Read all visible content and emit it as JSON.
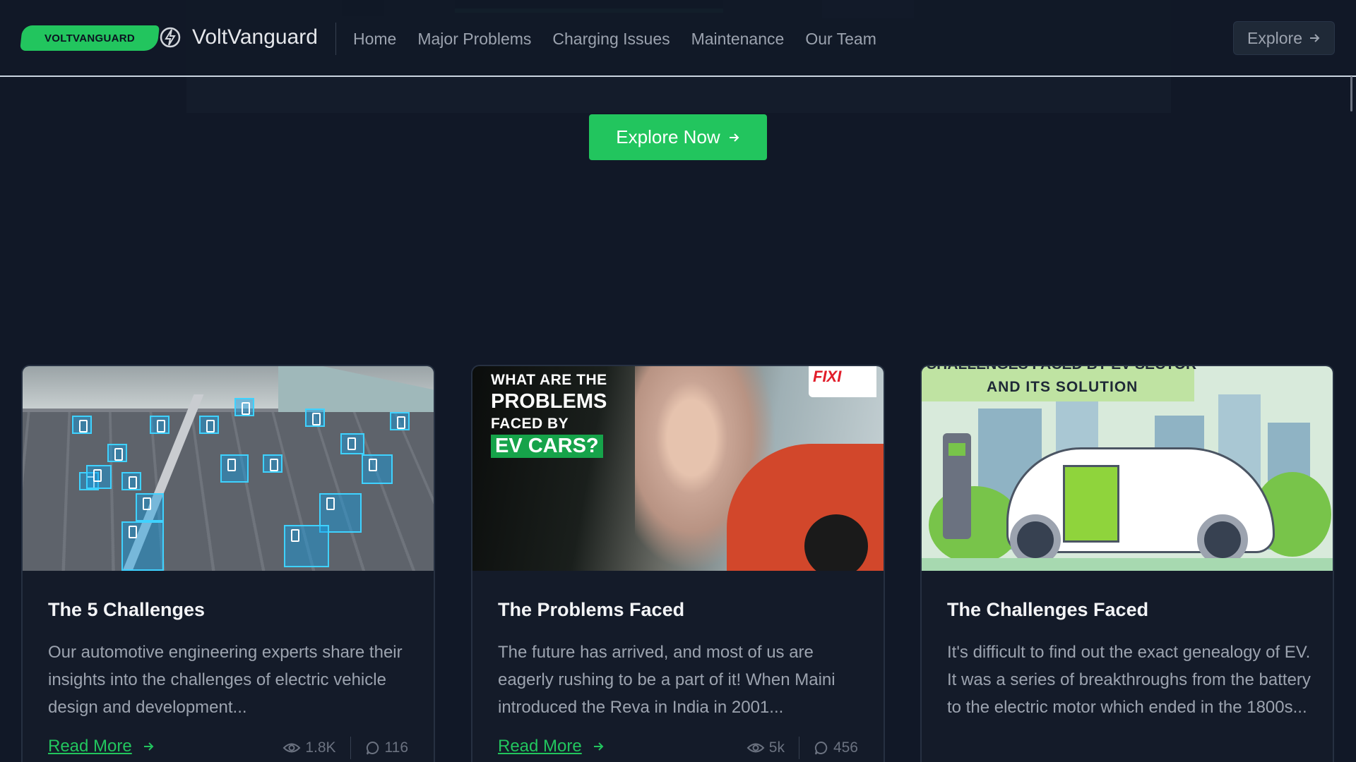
{
  "header": {
    "logo_badge": "VOLTVANGUARD",
    "brand_name": "VoltVanguard",
    "nav": [
      {
        "label": "Home"
      },
      {
        "label": "Major Problems"
      },
      {
        "label": "Charging Issues"
      },
      {
        "label": "Maintenance"
      },
      {
        "label": "Our Team"
      }
    ],
    "explore_label": "Explore"
  },
  "hero": {
    "cta_label": "Explore Now"
  },
  "cards": [
    {
      "title": "The 5 Challenges",
      "description": "Our automotive engineering experts share their insights into the challenges of electric vehicle design and development...",
      "read_more": "Read More",
      "views": "1.8K",
      "comments": "116",
      "image": "highway-ev-traffic"
    },
    {
      "title": "The Problems Faced",
      "description": "The future has arrived, and most of us are eagerly rushing to be a part of it! When Maini introduced the Reva in India in 2001...",
      "read_more": "Read More",
      "views": "5k",
      "comments": "456",
      "image": "woman-charging-ev",
      "image_text": {
        "line1": "WHAT ARE THE",
        "line2": "PROBLEMS",
        "line3": "FACED BY",
        "line4": "EV CARS?",
        "brand": "FIXI"
      }
    },
    {
      "title": "The Challenges Faced",
      "description": "It's difficult to find out the exact genealogy of EV. It was a series of breakthroughs from the battery to the electric motor which ended in the 1800s...",
      "image": "ev-charging-illustration",
      "image_text": {
        "line1": "CHALLENGES FACED BY EV SECTOR",
        "line2": "AND ITS SOLUTION"
      }
    }
  ],
  "colors": {
    "background": "#111827",
    "accent": "#22c55e",
    "card_bg": "#141b29",
    "muted_text": "#9ca3af"
  }
}
